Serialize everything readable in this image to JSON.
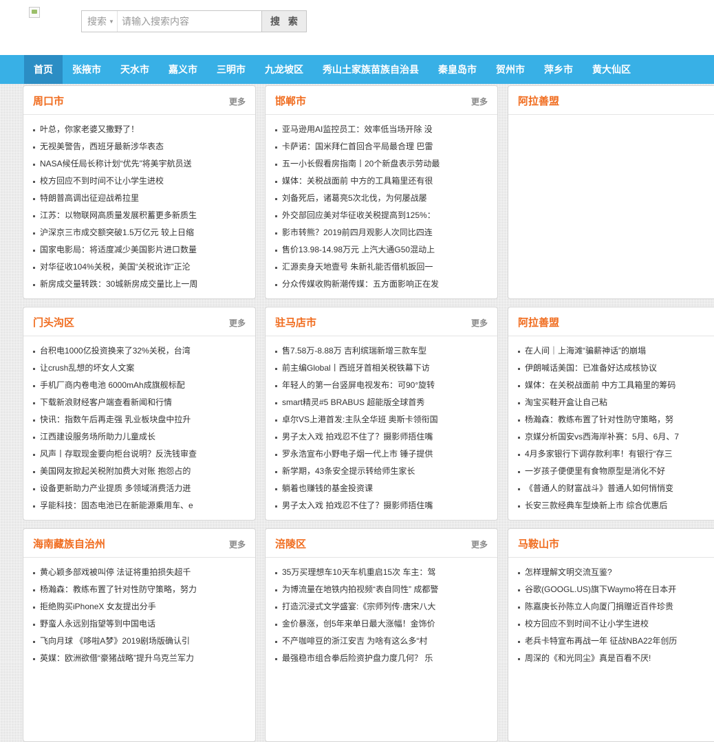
{
  "search": {
    "type_label": "搜索",
    "placeholder": "请输入搜索内容",
    "button_label": "搜 索"
  },
  "nav": {
    "items": [
      "首页",
      "张掖市",
      "天水市",
      "嘉义市",
      "三明市",
      "九龙坡区",
      "秀山土家族苗族自治县",
      "秦皇岛市",
      "贺州市",
      "萍乡市",
      "黄大仙区"
    ],
    "active_index": 0
  },
  "more_label": "更多",
  "panels": [
    {
      "title": "周口市",
      "items": [
        "叶总，你家老婆又撒野了！",
        "无视美警告，西班牙最新涉华表态",
        "NASA候任局长称计划“优先”将美宇航员送",
        "校方回应不到时间不让小学生进校",
        "特朗普高调出征迎战希拉里",
        "江苏：以物联网高质量发展积蓄更多新质生",
        "沪深京三市成交额突破1.5万亿元 较上日缩",
        "国家电影局：将适度减少美国影片进口数量",
        "对华征收104%关税，美国“关税讹诈”正沦",
        "新房成交量转跌：30城新房成交量比上一周"
      ]
    },
    {
      "title": "邯郸市",
      "items": [
        "亚马逊用AI监控员工：效率低当场开除 没",
        "卡萨诺：国米拜仁首回合平局最合理 巴雷",
        "五一小长假看房指南丨20个新盘表示劳动最",
        "媒体：关税战面前 中方的工具箱里还有很",
        "刘备死后，诸葛亮5次北伐，为何屡战屡",
        "外交部回应美对华征收关税提高到125%：",
        "影市转熊？2019前四月观影人次同比四连",
        "售价13.98-14.98万元 上汽大通G50混动上",
        "汇源卖身天地壹号 朱新礼能否借机扳回一",
        "分众传媒收购新潮传媒：五方面影响正在发"
      ]
    },
    {
      "title": "阿拉善盟",
      "items": []
    },
    {
      "title": "门头沟区",
      "items": [
        "台积电1000亿投资换来了32%关税，台湾",
        "让crush乱想的坏女人文案",
        "手机厂商内卷电池 6000mAh成旗舰标配",
        "下载新浪财经客户端查看新闻和行情",
        "快讯：指数午后再走强 乳业板块盘中拉升",
        "江西建设服务场所助力儿童成长",
        "风声丨存取现金要向柜台说明？反洗钱审查",
        "美国网友掀起关税附加费大对账 抱怨占的",
        "设备更新助力产业提质 多领域消费活力迸",
        "孚能科技：固态电池已在新能源乘用车、e"
      ]
    },
    {
      "title": "驻马店市",
      "items": [
        "售7.58万-8.88万 吉利缤瑞新增三款车型",
        "前主编Global丨西班牙首相关税铁幕下访",
        "年轻人的第一台竖屏电视发布：可90°旋转",
        "smart精灵#5 BRABUS 超能版全球首秀",
        "卓尔VS上港首发:主队全华班 奥斯卡领衔国",
        "男子太入戏 拍戏忍不住了？摄影师捂住嘴",
        "罗永浩宣布小野电子烟一代上市 锤子提供",
        "新学期，43条安全提示转给师生家长",
        "躺着也赚钱的基金投资课",
        "男子太入戏 拍戏忍不住了？摄影师捂住嘴"
      ]
    },
    {
      "title": "阿拉善盟",
      "items": [
        "在人间｜上海滩“骗薪神话”的崩塌",
        "伊朗喊话美国：已准备好达成核协议",
        "媒体：在关税战面前 中方工具箱里的筹码",
        "淘宝买鞋开盒让自己粘",
        "杨瀚森：教练布置了针对性防守策略，努",
        "京媒分析国安vs西海岸补赛：5月、6月、7",
        "4月多家银行下调存款利率！有银行“存三",
        "一岁孩子便便里有食物原型是消化不好",
        "《普通人的财富战斗》普通人如何悄悄变",
        "长安三款经典车型焕新上市 综合优惠后"
      ]
    },
    {
      "title": "海南藏族自治州",
      "items": [
        "黄心颖多部戏被叫停 法证将重拍损失超千",
        "杨瀚森：教练布置了针对性防守策略，努力",
        "拒绝购买iPhoneX 女友提出分手",
        "野蛮人永远别指望等到中国电话",
        "飞向月球 《哆啦A梦》2019剧场版确认引",
        "英媒：欧洲欲借“豪猪战略”提升乌克兰军力"
      ]
    },
    {
      "title": "涪陵区",
      "items": [
        "35万买理想车10天车机重启15次 车主：驾",
        "为博流量在地铁内拍视频“表自同性” 成都警",
        "打造沉浸式文学盛宴:《宗师列传·唐宋八大",
        "金价暴涨，创5年来单日最大涨幅！金饰价",
        "不产咖啡豆的浙江安吉 为啥有这么多“村",
        "最强稳市组合拳后险资护盘力度几何？ 乐"
      ]
    },
    {
      "title": "马鞍山市",
      "items": [
        "怎样理解文明交流互鉴?",
        "谷歌(GOOGL.US)旗下Waymo将在日本开",
        "陈嘉庚长孙陈立人向厦门捐赠近百件珍贵",
        "校方回应不到时间不让小学生进校",
        "老兵卡特宣布再战一年 征战NBA22年创历",
        "周深的《和光同尘》真是百看不厌!"
      ]
    }
  ]
}
